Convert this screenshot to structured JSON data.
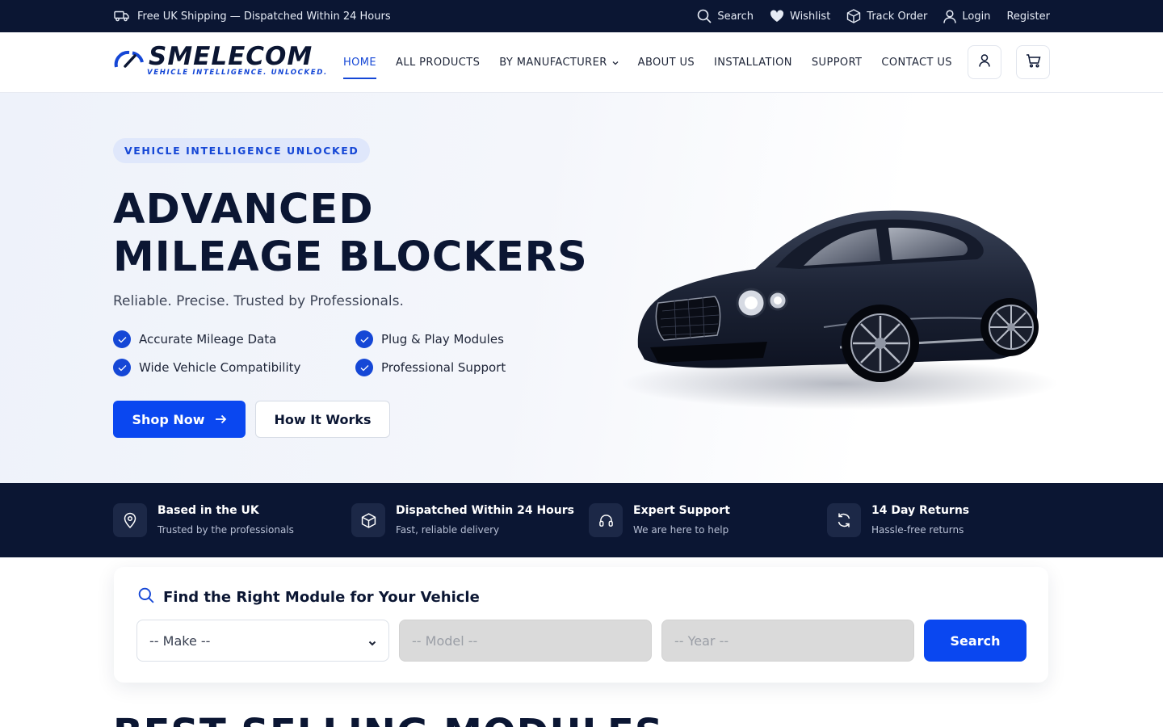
{
  "topbar": {
    "shipping_text": "Free UK Shipping — Dispatched Within 24 Hours",
    "links": [
      {
        "label": "Search",
        "icon": "search-icon"
      },
      {
        "label": "Wishlist",
        "icon": "heart-icon"
      },
      {
        "label": "Track Order",
        "icon": "box-icon"
      },
      {
        "label": "Login",
        "icon": "user-icon"
      },
      {
        "label": "Register",
        "icon": ""
      }
    ]
  },
  "brand": {
    "name": "SMELECOM",
    "tagline": "VEHICLE INTELLIGENCE. UNLOCKED.",
    "color": "#1547d6"
  },
  "nav": {
    "items": [
      "HOME",
      "ALL PRODUCTS",
      "BY MANUFACTURER",
      "ABOUT US",
      "INSTALLATION",
      "SUPPORT",
      "CONTACT US"
    ],
    "active": "HOME"
  },
  "hero": {
    "eyebrow": "VEHICLE INTELLIGENCE UNLOCKED",
    "title_line1": "ADVANCED",
    "title_line2": "MILEAGE BLOCKERS",
    "subtitle": "Reliable. Precise. Trusted by Professionals.",
    "features": [
      "Accurate Mileage Data",
      "Plug & Play Modules",
      "Wide Vehicle Compatibility",
      "Professional Support"
    ],
    "primary_cta": "Shop Now",
    "secondary_cta": "How It Works"
  },
  "strip": {
    "items": [
      {
        "title": "Based in the UK",
        "subtitle": "Trusted by the professionals",
        "icon": "location-pin-icon"
      },
      {
        "title": "Dispatched Within 24 Hours",
        "subtitle": "Fast, reliable delivery",
        "icon": "box-icon"
      },
      {
        "title": "Expert Support",
        "subtitle": "We are here to help",
        "icon": "headset-icon"
      },
      {
        "title": "14 Day Returns",
        "subtitle": "Hassle-free returns",
        "icon": "refresh-icon"
      }
    ]
  },
  "finder": {
    "title": "Find the Right Module for Your Vehicle",
    "make_placeholder": "-- Make --",
    "model_placeholder": "-- Model --",
    "year_placeholder": "-- Year --",
    "search_label": "Search"
  },
  "next_section": {
    "title": "BEST SELLING MODULES"
  },
  "colors": {
    "navy": "#0b1633",
    "accent": "#0a47f0"
  }
}
